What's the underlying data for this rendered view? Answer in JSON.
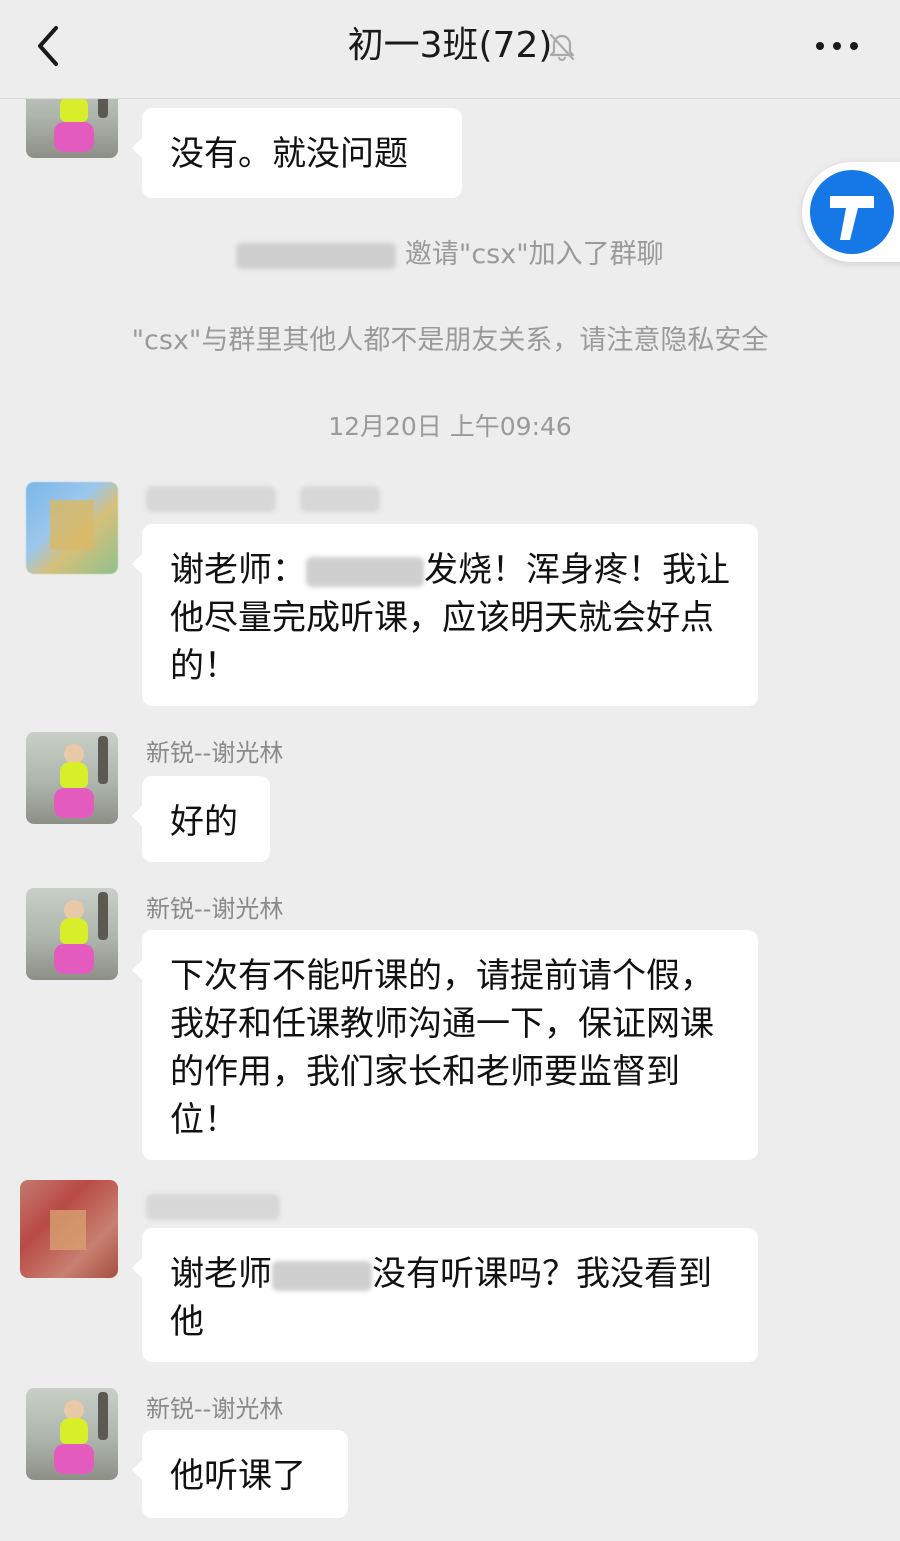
{
  "header": {
    "title": "初一3班(72)",
    "back_icon": "chevron-left-icon",
    "mute_icon": "bell-off-icon",
    "more_icon": "more-horizontal-icon"
  },
  "float_button": {
    "icon": "arrow-up-icon",
    "color": "#1677e6"
  },
  "messages": [
    {
      "text": "没有。就没问题"
    },
    {
      "system_invite": "邀请\"csx\"加入了群聊"
    },
    {
      "system_warning": "\"csx\"与群里其他人都不是朋友关系，请注意隐私安全"
    },
    {
      "timestamp": "12月20日 上午09:46"
    },
    {
      "text_pre": "谢老师：",
      "text_post": "发烧！浑身疼！我让他尽量完成听课，应该明天就会好点的！"
    },
    {
      "sender": "新锐--谢光林",
      "text": "好的"
    },
    {
      "sender": "新锐--谢光林",
      "text": "下次有不能听课的，请提前请个假，我好和任课教师沟通一下，保证网课的作用，我们家长和老师要监督到位！"
    },
    {
      "text_pre": "谢老师",
      "text_post": "没有听课吗？我没看到他"
    },
    {
      "sender": "新锐--谢光林",
      "text": "他听课了"
    }
  ],
  "colors": {
    "background": "#ededed",
    "bubble": "#ffffff",
    "meta_text": "#9a9a9a"
  }
}
